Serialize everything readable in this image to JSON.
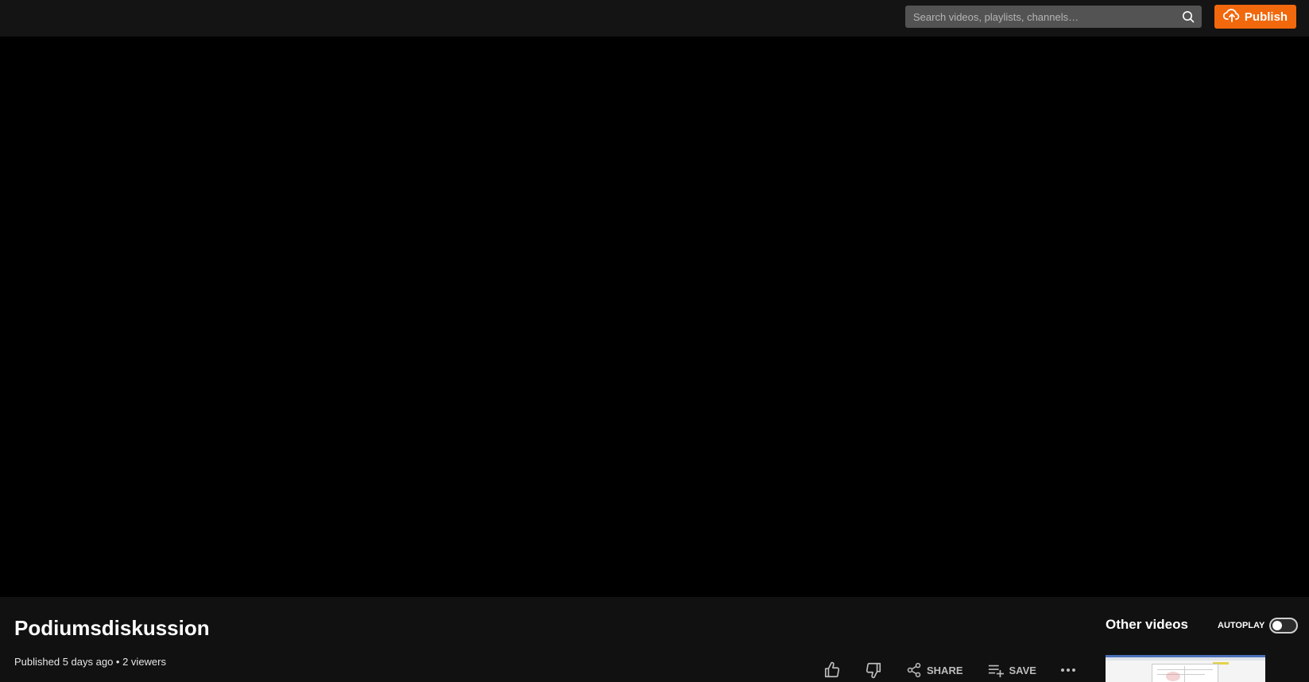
{
  "header": {
    "search_placeholder": "Search videos, playlists, channels…",
    "publish_label": "Publish"
  },
  "video": {
    "title": "Podiumsdiskussion",
    "meta": "Published 5 days ago • 2 viewers"
  },
  "actions": {
    "like_icon": "thumbs-up-icon",
    "dislike_icon": "thumbs-down-icon",
    "share_label": "SHARE",
    "save_label": "SAVE",
    "more_icon": "more-horizontal-icon"
  },
  "sidebar": {
    "title": "Other videos",
    "autoplay_label": "AUTOPLAY",
    "autoplay_on": false
  },
  "colors": {
    "accent": "#f1680d",
    "background": "#111111",
    "player": "#000000"
  }
}
